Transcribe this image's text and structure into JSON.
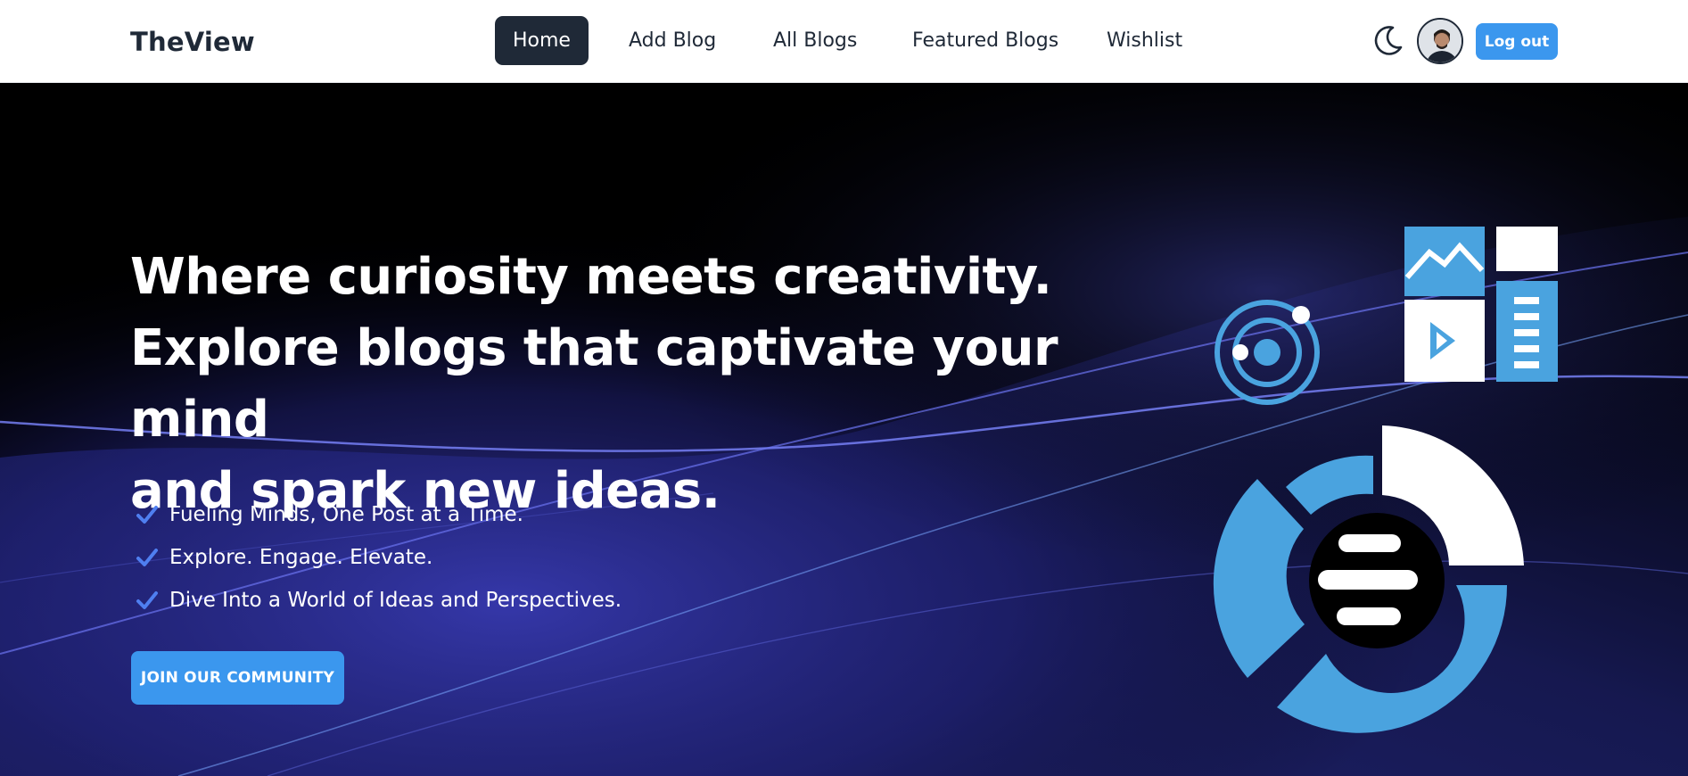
{
  "nav": {
    "brand": "TheView",
    "links": [
      {
        "label": "Home",
        "active": true
      },
      {
        "label": "Add Blog"
      },
      {
        "label": "All Blogs"
      },
      {
        "label": "Featured Blogs"
      },
      {
        "label": "Wishlist"
      }
    ],
    "theme_icon": "moon-icon",
    "logout_label": "Log out"
  },
  "hero": {
    "headline_lines": [
      "Where curiosity meets creativity.",
      "Explore blogs that captivate your mind",
      "and spark new ideas."
    ],
    "features": [
      "Fueling Minds, One Post at a Time.",
      "Explore. Engage. Elevate.",
      "Dive Into a World of Ideas and Perspectives."
    ],
    "cta_label": "JOIN OUR COMMUNITY"
  },
  "colors": {
    "accent": "#3b97ee",
    "nav_active_bg": "#1f2937",
    "text_dark": "#1f2937",
    "illustration_blue": "#4aa3df"
  }
}
